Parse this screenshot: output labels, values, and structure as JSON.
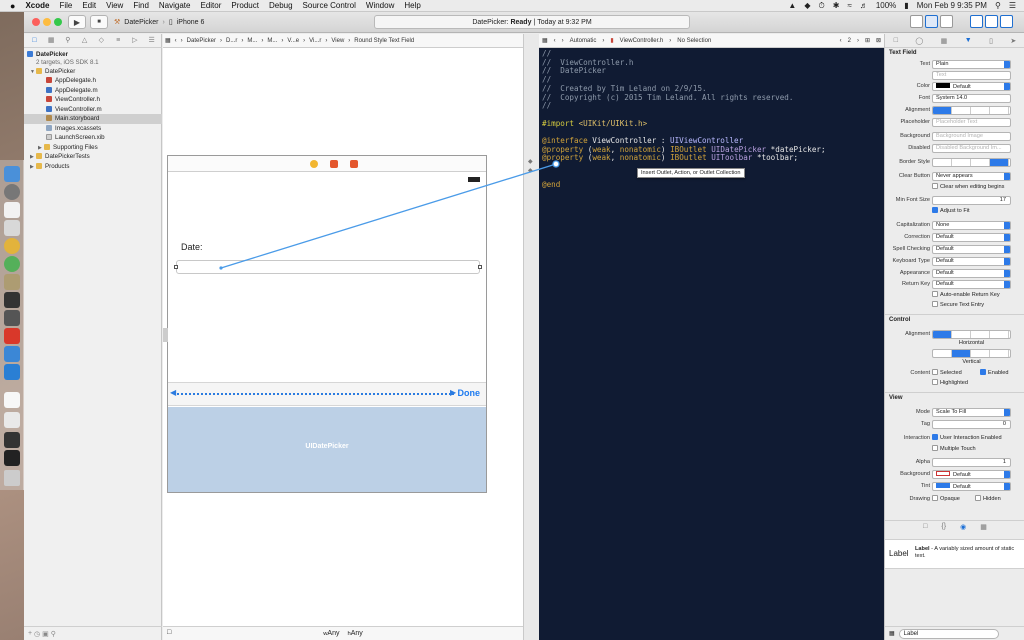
{
  "menubar": {
    "apple": "",
    "items": [
      "Xcode",
      "File",
      "Edit",
      "View",
      "Find",
      "Navigate",
      "Editor",
      "Product",
      "Debug",
      "Source Control",
      "Window",
      "Help"
    ],
    "battery": "100%",
    "clock": "Mon Feb 9  9:35 PM"
  },
  "toolbar": {
    "scheme": "DatePicker",
    "device": "iPhone 6",
    "activity_project": "DatePicker:",
    "activity_status": "Ready",
    "activity_time": "Today at 9:32 PM",
    "run": "▶",
    "stop": "■"
  },
  "navigator": {
    "project": "DatePicker",
    "project_sub": "2 targets, iOS SDK 8.1",
    "items": [
      {
        "label": "DatePicker",
        "kind": "group"
      },
      {
        "label": "AppDelegate.h",
        "kind": "h"
      },
      {
        "label": "AppDelegate.m",
        "kind": "m"
      },
      {
        "label": "ViewController.h",
        "kind": "h"
      },
      {
        "label": "ViewController.m",
        "kind": "m"
      },
      {
        "label": "Main.storyboard",
        "kind": "sb"
      },
      {
        "label": "Images.xcassets",
        "kind": "assets"
      },
      {
        "label": "LaunchScreen.xib",
        "kind": "xib"
      },
      {
        "label": "Supporting Files",
        "kind": "group"
      },
      {
        "label": "DatePickerTests",
        "kind": "group"
      },
      {
        "label": "Products",
        "kind": "group"
      }
    ]
  },
  "canvas": {
    "jumpbar": [
      "DatePicker",
      "D...r",
      "M...",
      "M...",
      "V...e",
      "Vi...r",
      "View",
      "Round Style Text Field"
    ],
    "date_label": "Date:",
    "done": "Done",
    "picker_label": "UIDatePicker",
    "size_w": "Any",
    "size_h": "Any",
    "size_w_prefix": "w",
    "size_h_prefix": "h"
  },
  "editor": {
    "jumpbar": [
      "Automatic",
      "ViewController.h",
      "No Selection"
    ],
    "page": "2",
    "tooltip": "Insert Outlet, Action, or Outlet Collection"
  },
  "inspector": {
    "section_textfield": "Text Field",
    "text_mode": "Plain",
    "text_placeholder": "Text",
    "color": "Default",
    "font": "System 14.0",
    "placeholder": "Placeholder Text",
    "background_image": "Background Image",
    "disabled_image": "Disabled Background Im...",
    "clear_button": "Never appears",
    "clear_editing": "Clear when editing begins",
    "min_font_size": "17",
    "adjust_to_fit": "Adjust to Fit",
    "capitalization": "None",
    "correction": "Default",
    "spell_checking": "Default",
    "keyboard_type": "Default",
    "appearance": "Default",
    "return_key": "Default",
    "auto_enable": "Auto-enable Return Key",
    "secure": "Secure Text Entry",
    "section_control": "Control",
    "horizontal": "Horizontal",
    "vertical": "Vertical",
    "content_selected": "Selected",
    "content_enabled": "Enabled",
    "content_highlighted": "Highlighted",
    "section_view": "View",
    "mode": "Scale To Fill",
    "tag": "0",
    "user_interaction": "User Interaction Enabled",
    "multiple_touch": "Multiple Touch",
    "alpha": "1",
    "background": "Default",
    "tint": "Default",
    "opaque": "Opaque",
    "hidden": "Hidden",
    "labels": {
      "text": "Text",
      "color": "Color",
      "font": "Font",
      "alignment": "Alignment",
      "placeholder": "Placeholder",
      "background": "Background",
      "disabled": "Disabled",
      "border_style": "Border Style",
      "clear_button": "Clear Button",
      "min_font": "Min Font Size",
      "capitalization": "Capitalization",
      "correction": "Correction",
      "spell": "Spell Checking",
      "keyboard": "Keyboard Type",
      "appearance": "Appearance",
      "return_key": "Return Key",
      "ctrl_alignment": "Alignment",
      "content": "Content",
      "mode": "Mode",
      "tag": "Tag",
      "interaction": "Interaction",
      "alpha": "Alpha",
      "bg": "Background",
      "tint": "Tint",
      "drawing": "Drawing"
    },
    "library_big": "Label",
    "library_title": "Label",
    "library_desc": " - A variably sized amount of static text.",
    "library_filter": "Label"
  }
}
